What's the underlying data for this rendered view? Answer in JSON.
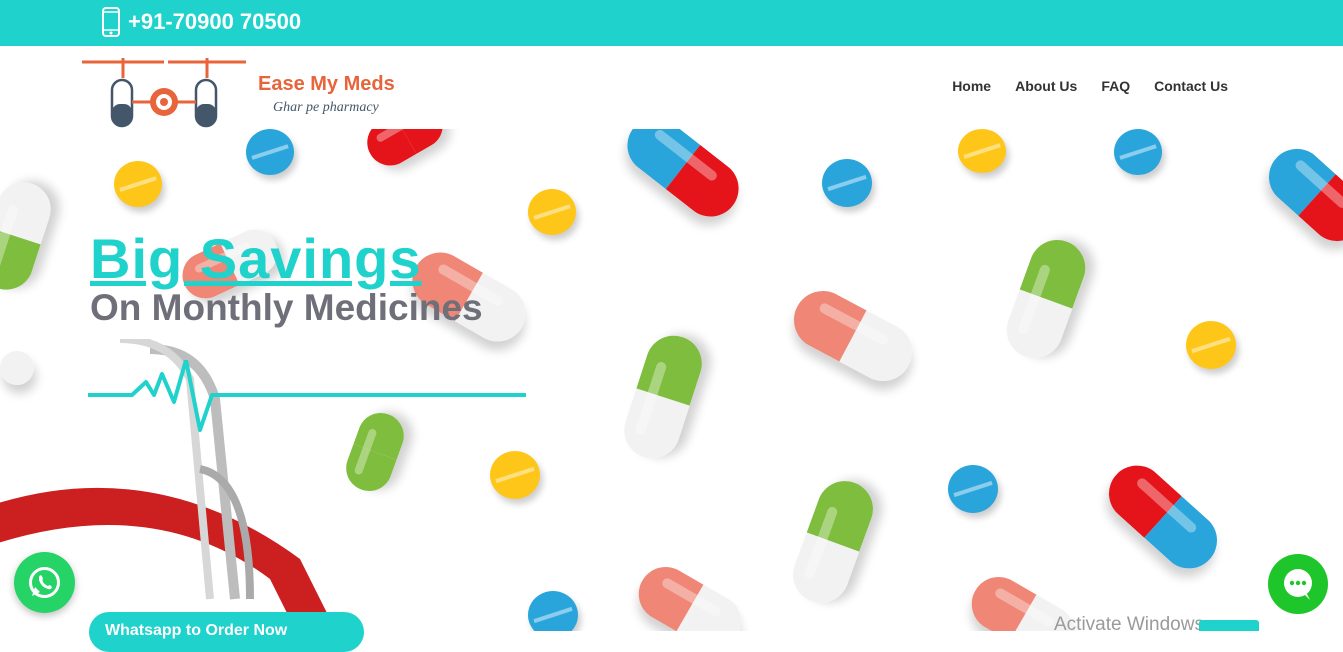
{
  "topbar": {
    "phone": "+91-70900 70500"
  },
  "header": {
    "brand_name": "Ease My Meds",
    "tagline": "Ghar pe pharmacy",
    "nav": [
      {
        "label": "Home"
      },
      {
        "label": "About Us"
      },
      {
        "label": "FAQ"
      },
      {
        "label": "Contact Us"
      }
    ]
  },
  "hero": {
    "headline": "Big Savings",
    "subline": "On Monthly Medicines",
    "cta_label": "Whatsapp to Order Now"
  },
  "footer_overlay": {
    "activate_text": "Activate Windows"
  },
  "icons": {
    "phone": "phone-icon",
    "whatsapp": "whatsapp-icon",
    "chat": "chat-icon",
    "logo": "drone-pharmacy-logo"
  },
  "colors": {
    "accent": "#1fd2cb",
    "brand_orange": "#e8643a",
    "whatsapp": "#25d366",
    "chat": "#1ec52b",
    "subtext": "#6f6f7a"
  }
}
